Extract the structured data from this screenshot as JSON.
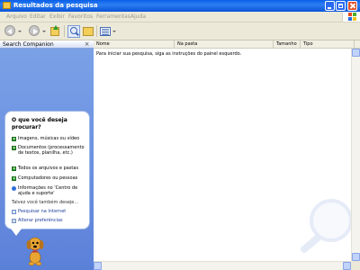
{
  "window": {
    "title": "Resultados da pesquisa"
  },
  "menu": {
    "items": [
      "Arquivo",
      "Editar",
      "Exibir",
      "Favoritos",
      "Ferramentas",
      "Ajuda"
    ]
  },
  "search_companion": {
    "title": "Search Companion",
    "question": "O que você deseja procurar?",
    "options": [
      "Imagens, músicas ou vídeo",
      "Documentos (processamento de textos, planilha, etc.)",
      "Todos os arquivos e pastas",
      "Computadores ou pessoas",
      "Informações no 'Centro de ajuda e suporte'"
    ],
    "also_label": "Talvez você também deseje...",
    "extra_options": [
      "Pesquisar na Internet",
      "Alterar preferências"
    ]
  },
  "results": {
    "columns": [
      "Nome",
      "Na pasta",
      "Tamanho",
      "Tipo"
    ],
    "hint": "Para iniciar sua pesquisa, siga as instruções do painel esquerdo."
  }
}
